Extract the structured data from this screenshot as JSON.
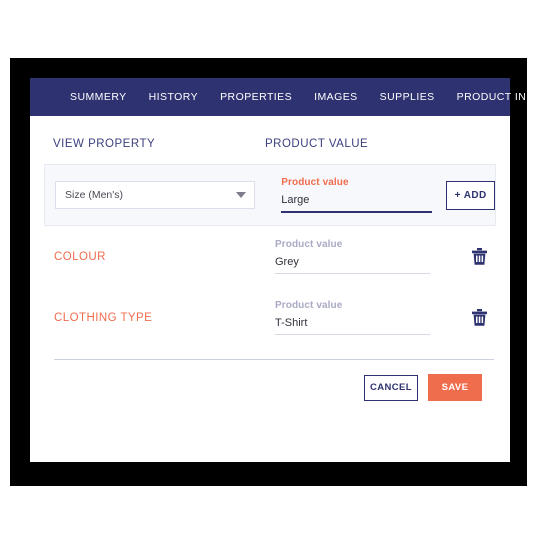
{
  "theme": {
    "nav_bg": "#2e3270",
    "accent": "#ef6c4d",
    "heading": "#3b3f7e",
    "muted_label": "#a9aac4",
    "frame": "#000000",
    "row_bg": "#f7f8fc"
  },
  "nav": {
    "items": [
      {
        "label": "SUMMERY"
      },
      {
        "label": "HISTORY"
      },
      {
        "label": "PROPERTIES"
      },
      {
        "label": "IMAGES"
      },
      {
        "label": "SUPPLIES"
      },
      {
        "label": "PRODUCT INFO"
      }
    ]
  },
  "columns": {
    "property": "VIEW PROPERTY",
    "value": "PRODUCT VALUE"
  },
  "new_row": {
    "select_value": "Size (Men's)",
    "select_icon": "chevron-down-icon",
    "value_label": "Product value",
    "value_text": "Large",
    "add_label": "+ ADD"
  },
  "rows": [
    {
      "name": "COLOUR",
      "value_label": "Product value",
      "value_text": "Grey",
      "delete_icon": "trash-icon"
    },
    {
      "name": "CLOTHING TYPE",
      "value_label": "Product value",
      "value_text": "T-Shirt",
      "delete_icon": "trash-icon"
    }
  ],
  "footer": {
    "cancel_label": "CANCEL",
    "save_label": "SAVE"
  }
}
